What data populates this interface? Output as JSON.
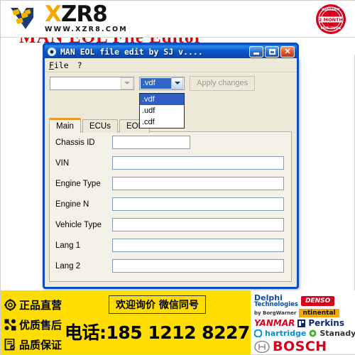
{
  "site_header": {
    "logo_text_yellow": "X",
    "logo_text_black": "ZR8",
    "logo_url": "WWW.XZR8.COM",
    "badge_line1": "WARRANTY",
    "badge_line2": "12 MONTHS",
    "badge_line3": "WORLDWIDE"
  },
  "marquee": {
    "red_title": "MAN EOL File Editor"
  },
  "window": {
    "title": "MAN EOL file edit by SJ v....",
    "buttons": {
      "minimize": "_",
      "maximize": "□",
      "close": "×"
    },
    "menu": [
      {
        "label": "File",
        "accel": "F"
      },
      {
        "label": "?",
        "accel": ""
      }
    ],
    "toolbar": {
      "file_combo_value": "",
      "ext_combo_value": ".vdf",
      "apply_label": "Apply changes",
      "ext_options": [
        ".vdf",
        ".udf",
        ".cdf"
      ],
      "ext_selected_index": 0
    },
    "tabs": [
      {
        "label": "Main",
        "active": true
      },
      {
        "label": "ECUs",
        "active": false
      },
      {
        "label": "EOL",
        "active": false
      }
    ],
    "fields": [
      {
        "label": "Chassis ID",
        "value": "",
        "short": true
      },
      {
        "label": "VIN",
        "value": "",
        "short": false
      },
      {
        "label": "Engine Type",
        "value": "",
        "short": false
      },
      {
        "label": "Engine N",
        "value": "",
        "short": false
      },
      {
        "label": "Vehicle Type",
        "value": "",
        "short": false
      },
      {
        "label": "Lang 1",
        "value": "",
        "short": false
      },
      {
        "label": "Lang 2",
        "value": "",
        "short": false
      }
    ]
  },
  "banner": {
    "slogans": [
      {
        "icon": "gear-icon",
        "text": "正品直营"
      },
      {
        "icon": "share-icon",
        "text": "优质售后"
      },
      {
        "icon": "doc-icon",
        "text": "品质保证"
      }
    ],
    "promo_box": "欢迎询价  微信同号",
    "phone": "电话:185 1212 8227",
    "brands": {
      "delphi": "Delphi",
      "delphi_sub": "Technologies",
      "borg": "by BorgWarner",
      "denso": "DENSO",
      "continental": "ntinental",
      "yanmar": "YANMAR",
      "perkins": "Perkins",
      "hartridge": "hartridge",
      "stanadyne": "Stanadyne",
      "bosch": "BOSCH"
    }
  },
  "colors": {
    "title_blue": "#0a4fc0",
    "tab_accent": "#e79a2b",
    "banner_yellow": "#ffdd00",
    "brand_red": "#d6001c",
    "logo_yellow": "#f5a800",
    "marquee_red": "#e00000"
  }
}
